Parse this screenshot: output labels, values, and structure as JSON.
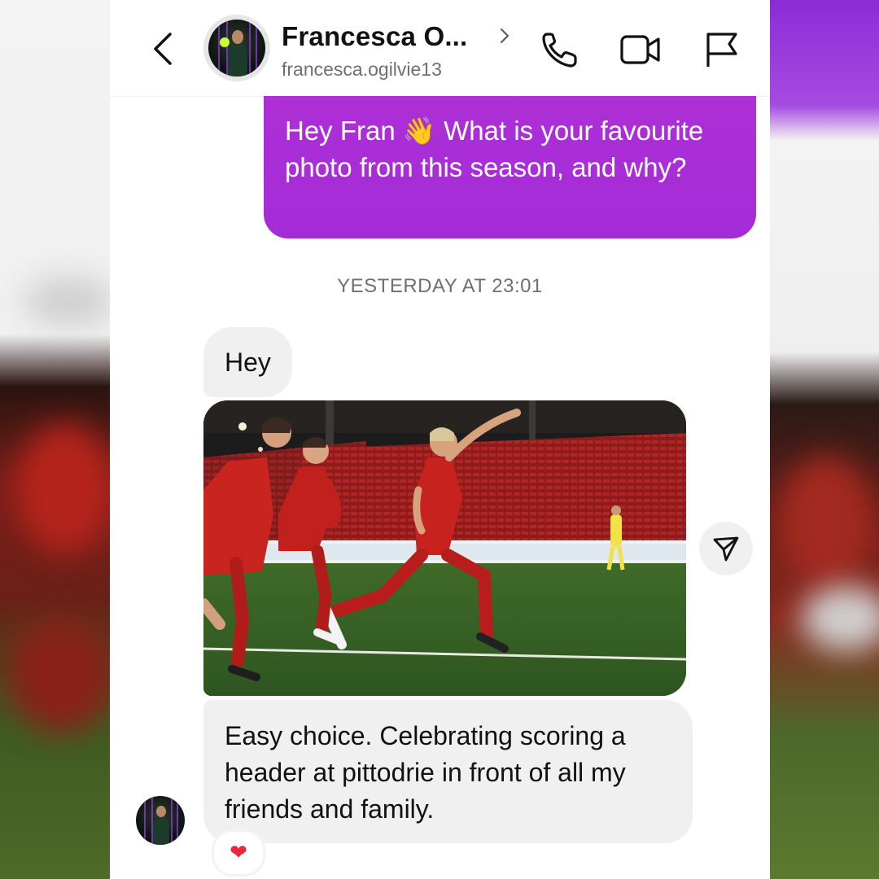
{
  "header": {
    "contact_name": "Francesca O...",
    "username": "francesca.ogilvie13",
    "icons": [
      "back-icon",
      "chevron-right-icon",
      "phone-icon",
      "video-camera-icon",
      "flag-icon"
    ]
  },
  "messages": {
    "outgoing_text": "Hey Fran 👋 What is your favourite photo from this season, and why?",
    "timestamp": "YESTERDAY AT 23:01",
    "incoming_greeting": "Hey",
    "incoming_reply": "Easy choice. Celebrating scoring a header at pittodrie in front of all my friends and family.",
    "reaction": "❤",
    "share_icon": "send-icon"
  },
  "colors": {
    "outgoing_bubble": "#a42cd8",
    "incoming_bubble": "#f0f0f0",
    "reaction_heart": "#e8273a"
  }
}
